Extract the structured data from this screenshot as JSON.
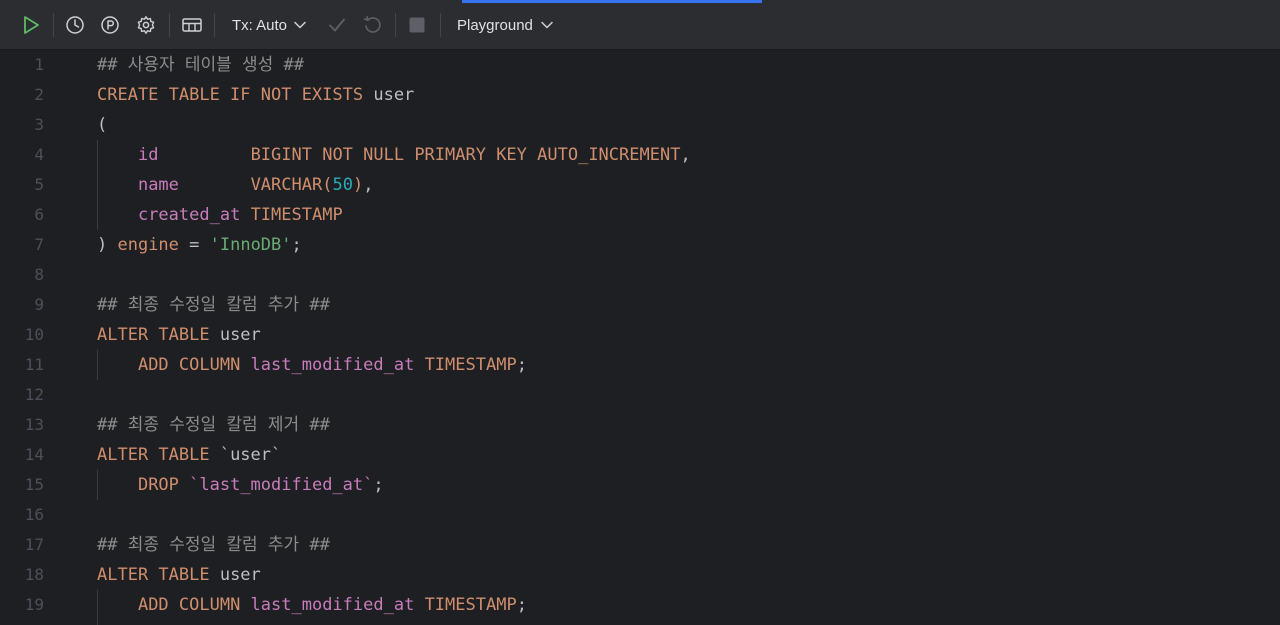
{
  "toolbar": {
    "tx_mode": "Tx: Auto",
    "playground": "Playground",
    "icons": [
      "run-icon",
      "history-icon",
      "parameters-icon",
      "settings-icon",
      "table-view-icon",
      "chevron-down-icon",
      "commit-icon",
      "rollback-icon",
      "stop-icon"
    ]
  },
  "colors": {
    "background": "#1e1f22",
    "toolbar": "#2b2d30",
    "keyword": "#cf8e6d",
    "comment": "#8c8c8c",
    "field": "#c77dbb",
    "number": "#2aacb8",
    "string": "#6aab73",
    "run_green": "#5fb865",
    "accent": "#3574f0"
  },
  "editor": {
    "lines": [
      {
        "num": "1",
        "tokens": [
          {
            "t": "## 사용자 테이블 생성 ##",
            "c": "comment"
          }
        ]
      },
      {
        "num": "2",
        "tokens": [
          {
            "t": "CREATE TABLE IF NOT EXISTS ",
            "c": "kw"
          },
          {
            "t": "user",
            "c": "id"
          }
        ]
      },
      {
        "num": "3",
        "tokens": [
          {
            "t": "(",
            "c": "punc"
          }
        ]
      },
      {
        "num": "4",
        "tokens": [
          {
            "t": "    ",
            "c": "punc"
          },
          {
            "t": "id",
            "c": "field"
          },
          {
            "t": "         ",
            "c": "punc"
          },
          {
            "t": "BIGINT NOT NULL PRIMARY KEY AUTO_INCREMENT",
            "c": "kw"
          },
          {
            "t": ",",
            "c": "punc"
          }
        ]
      },
      {
        "num": "5",
        "tokens": [
          {
            "t": "    ",
            "c": "punc"
          },
          {
            "t": "name",
            "c": "field"
          },
          {
            "t": "       ",
            "c": "punc"
          },
          {
            "t": "VARCHAR(",
            "c": "kw"
          },
          {
            "t": "50",
            "c": "num"
          },
          {
            "t": ")",
            "c": "kw"
          },
          {
            "t": ",",
            "c": "punc"
          }
        ]
      },
      {
        "num": "6",
        "tokens": [
          {
            "t": "    ",
            "c": "punc"
          },
          {
            "t": "created_at",
            "c": "field"
          },
          {
            "t": " ",
            "c": "punc"
          },
          {
            "t": "TIMESTAMP",
            "c": "kw"
          }
        ]
      },
      {
        "num": "7",
        "tokens": [
          {
            "t": ") ",
            "c": "punc"
          },
          {
            "t": "engine",
            "c": "kw"
          },
          {
            "t": " = ",
            "c": "punc"
          },
          {
            "t": "'InnoDB'",
            "c": "str"
          },
          {
            "t": ";",
            "c": "punc"
          }
        ]
      },
      {
        "num": "8",
        "tokens": []
      },
      {
        "num": "9",
        "tokens": [
          {
            "t": "## 최종 수정일 칼럼 추가 ##",
            "c": "comment"
          }
        ]
      },
      {
        "num": "10",
        "tokens": [
          {
            "t": "ALTER TABLE ",
            "c": "kw"
          },
          {
            "t": "user",
            "c": "id"
          }
        ]
      },
      {
        "num": "11",
        "tokens": [
          {
            "t": "    ",
            "c": "punc"
          },
          {
            "t": "ADD COLUMN ",
            "c": "kw"
          },
          {
            "t": "last_modified_at",
            "c": "field"
          },
          {
            "t": " ",
            "c": "punc"
          },
          {
            "t": "TIMESTAMP",
            "c": "kw"
          },
          {
            "t": ";",
            "c": "punc"
          }
        ]
      },
      {
        "num": "12",
        "tokens": []
      },
      {
        "num": "13",
        "tokens": [
          {
            "t": "## 최종 수정일 칼럼 제거 ##",
            "c": "comment"
          }
        ]
      },
      {
        "num": "14",
        "tokens": [
          {
            "t": "ALTER TABLE ",
            "c": "kw"
          },
          {
            "t": "`user`",
            "c": "id"
          }
        ]
      },
      {
        "num": "15",
        "tokens": [
          {
            "t": "    ",
            "c": "punc"
          },
          {
            "t": "DROP ",
            "c": "kw"
          },
          {
            "t": "`last_modified_at`",
            "c": "field"
          },
          {
            "t": ";",
            "c": "punc"
          }
        ]
      },
      {
        "num": "16",
        "tokens": []
      },
      {
        "num": "17",
        "tokens": [
          {
            "t": "## 최종 수정일 칼럼 추가 ##",
            "c": "comment"
          }
        ]
      },
      {
        "num": "18",
        "tokens": [
          {
            "t": "ALTER TABLE ",
            "c": "kw"
          },
          {
            "t": "user",
            "c": "id"
          }
        ]
      },
      {
        "num": "19",
        "tokens": [
          {
            "t": "    ",
            "c": "punc"
          },
          {
            "t": "ADD COLUMN ",
            "c": "kw"
          },
          {
            "t": "last_modified_at",
            "c": "field"
          },
          {
            "t": " ",
            "c": "punc"
          },
          {
            "t": "TIMESTAMP",
            "c": "kw"
          },
          {
            "t": ";",
            "c": "punc"
          }
        ]
      }
    ]
  }
}
